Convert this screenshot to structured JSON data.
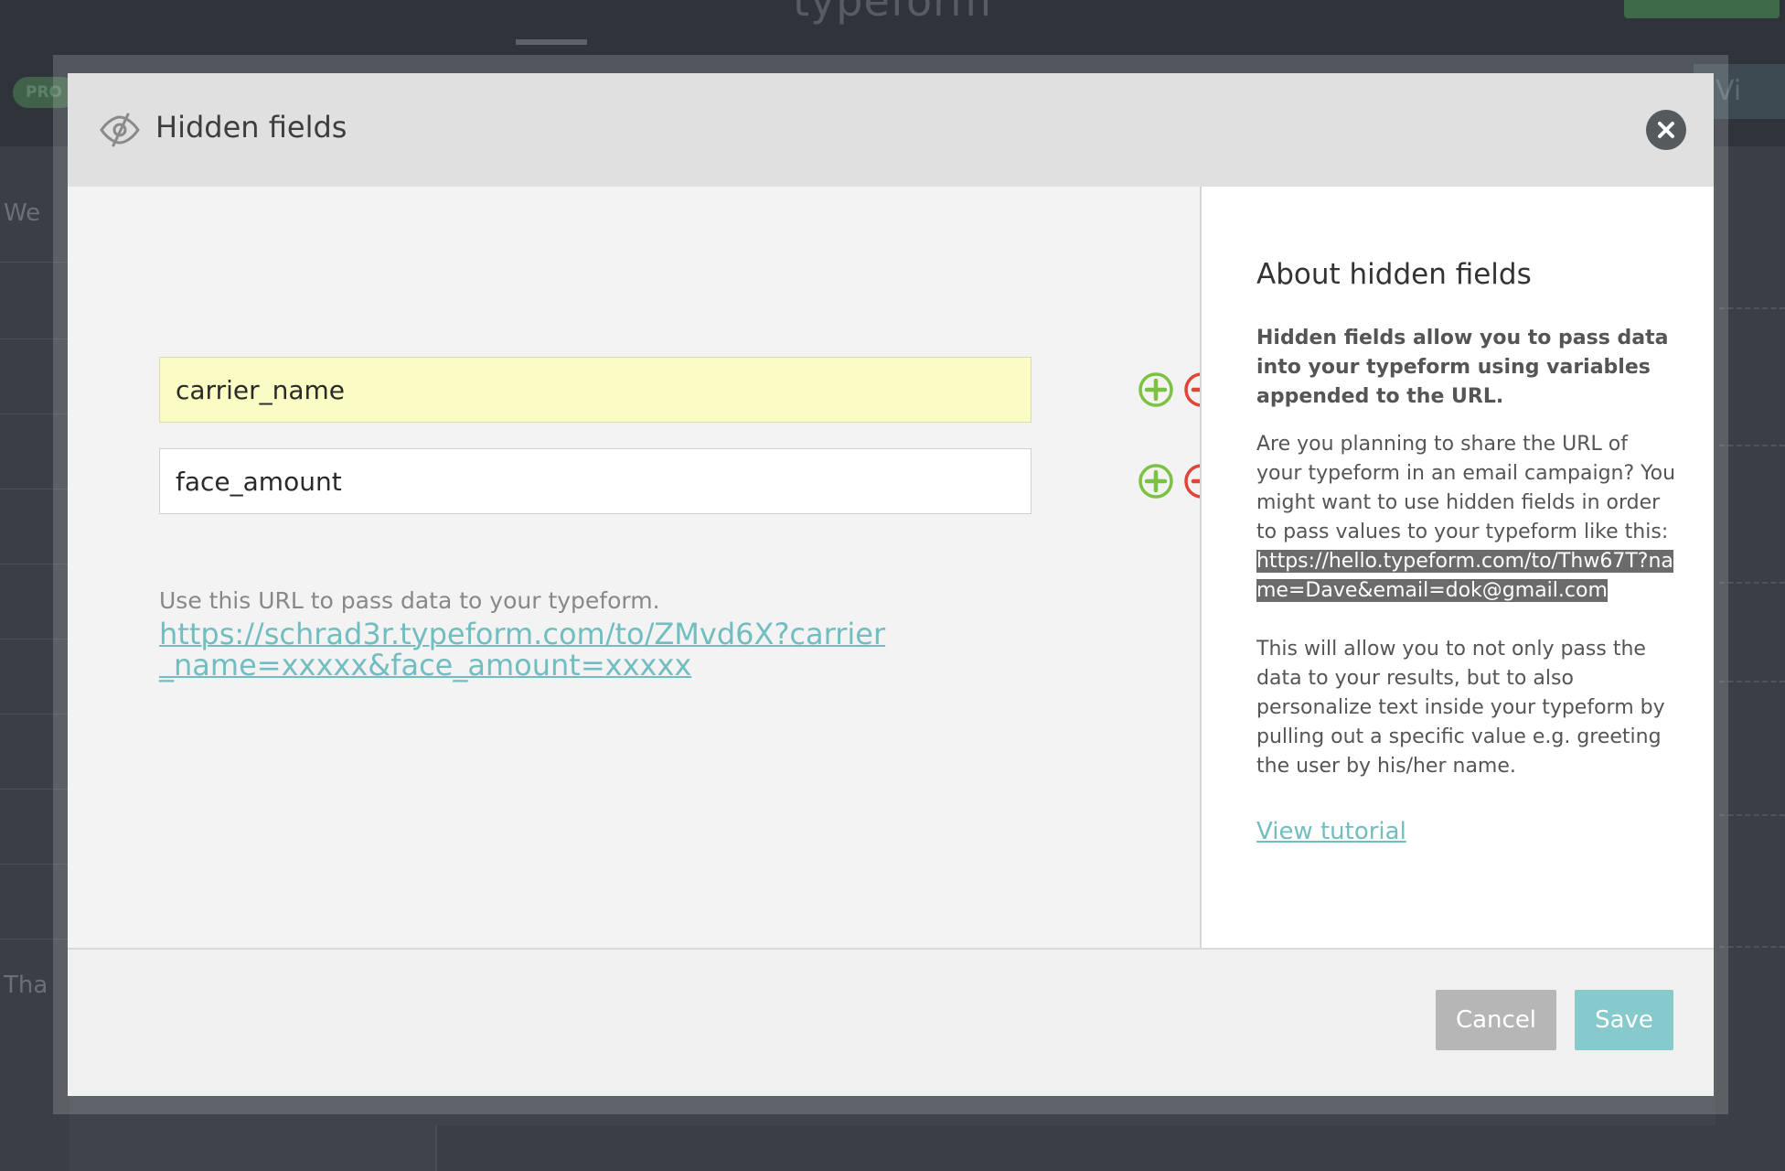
{
  "background_app": {
    "brand": "typeform",
    "pro_badge": "PRO",
    "view_label": "Vi",
    "sidebar_welcome": "We",
    "sidebar_thanks": "Tha"
  },
  "modal": {
    "title": "Hidden fields",
    "fields": [
      {
        "value": "carrier_name",
        "highlighted": true
      },
      {
        "value": "face_amount",
        "highlighted": false
      }
    ],
    "url_caption": "Use this URL to pass data to your typeform.",
    "url": "https://schrad3r.typeform.com/to/ZMvd6X?carrier_name=xxxxx&face_amount=xxxxx",
    "about": {
      "title": "About hidden fields",
      "lead": "Hidden fields allow you to pass data into your typeform using variables appended to the URL.",
      "paragraph1": "Are you planning to share the URL of your typeform in an email campaign? You might want to use hidden fields in order to pass values to your typeform like this:",
      "example_url": "https://hello.typeform.com/to/Thw67T?name=Dave&email=dok@gmail.com",
      "paragraph2": "This will allow you to not only pass the data to your results, but to also personalize text inside your typeform by pulling out a specific value e.g. greeting the user by his/her name.",
      "tutorial_link": "View tutorial"
    },
    "buttons": {
      "cancel": "Cancel",
      "save": "Save"
    }
  },
  "colors": {
    "accent_teal": "#72bdbf",
    "save_button": "#86cacc",
    "add_green": "#7cc242",
    "remove_red": "#e2443a",
    "highlight_field": "#fafcc4"
  },
  "icons": {
    "header": "eye-slash-icon",
    "close": "close-icon",
    "add": "plus-circle-icon",
    "remove": "minus-circle-icon"
  }
}
